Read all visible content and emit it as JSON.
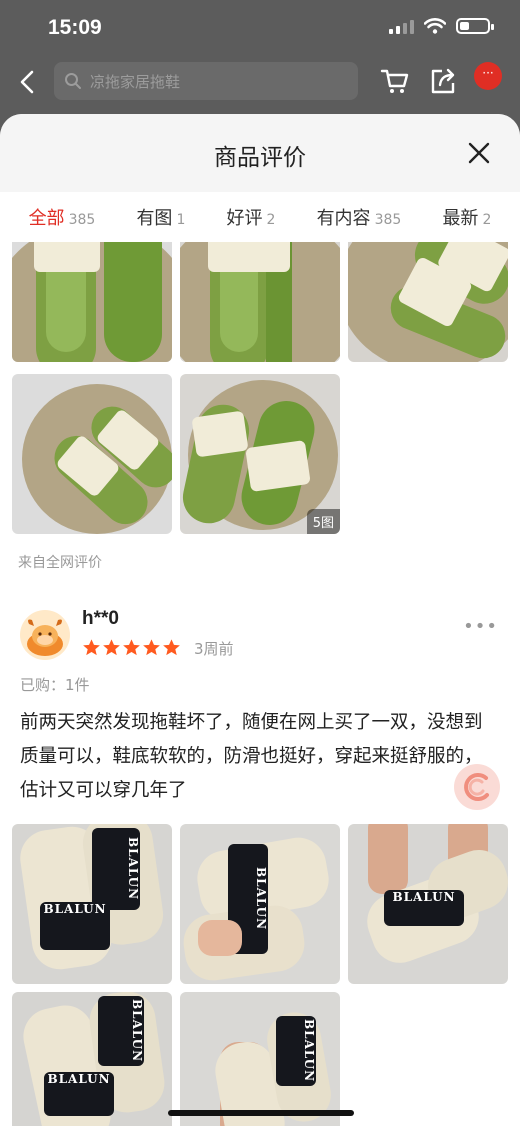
{
  "status_bar": {
    "time": "15:09"
  },
  "top_nav": {
    "search_placeholder": "凉拖家居拖鞋",
    "message_badge": "···"
  },
  "sheet": {
    "title": "商品评价",
    "tabs": [
      {
        "label": "全部",
        "count": "385",
        "active": true
      },
      {
        "label": "有图",
        "count": "1"
      },
      {
        "label": "好评",
        "count": "2"
      },
      {
        "label": "有内容",
        "count": "385"
      },
      {
        "label": "最新",
        "count": "2"
      }
    ]
  },
  "first_gallery": {
    "image_count_badge": "5图",
    "source_note": "来自全网评价"
  },
  "review": {
    "username": "h**0",
    "rating": 5,
    "time_ago": "3周前",
    "purchased": "已购：1件",
    "text": "前两天突然发现拖鞋坏了，随便在网上买了一双，没想到质量可以，鞋底软软的，防滑也挺好，穿起来挺舒服的，估计又可以穿几年了",
    "strap_brand": "BLALUN"
  },
  "colors": {
    "accent": "#e02e24",
    "star": "#ff5a1f",
    "green_slide": "#7ea043",
    "strap_cream": "#f1ecd8",
    "black_strap": "#15171d",
    "beige_slide": "#ece5d2"
  }
}
